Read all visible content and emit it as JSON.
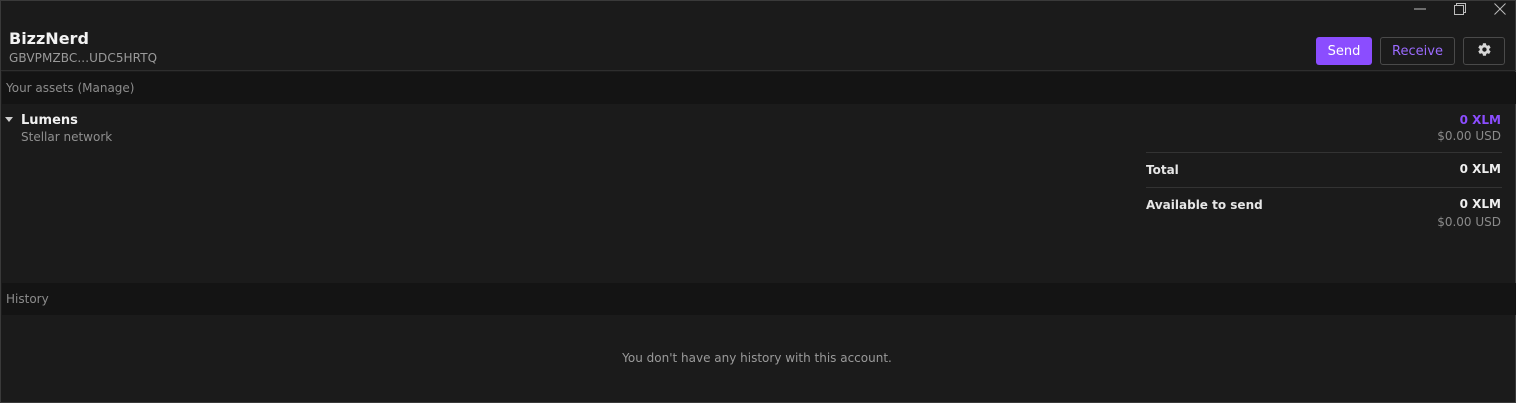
{
  "window_controls": {
    "minimize": "minimize-icon",
    "restore": "restore-icon",
    "close": "close-icon"
  },
  "account": {
    "name": "BizzNerd",
    "address": "GBVPMZBC...UDC5HRTQ"
  },
  "actions": {
    "send_label": "Send",
    "receive_label": "Receive",
    "settings_icon": "gear-icon"
  },
  "assets": {
    "section_title": "Your assets (Manage)",
    "items": [
      {
        "name": "Lumens",
        "network": "Stellar network",
        "amount": "0 XLM",
        "usd": "$0.00 USD"
      }
    ],
    "total_label": "Total",
    "total_value": "0 XLM",
    "available_label": "Available to send",
    "available_value": "0 XLM",
    "available_usd": "$0.00 USD"
  },
  "history": {
    "section_title": "History",
    "empty_message": "You don't have any history with this account."
  },
  "colors": {
    "accent": "#8b4dff",
    "background": "#1b1b1b",
    "section_bar": "#141414"
  }
}
